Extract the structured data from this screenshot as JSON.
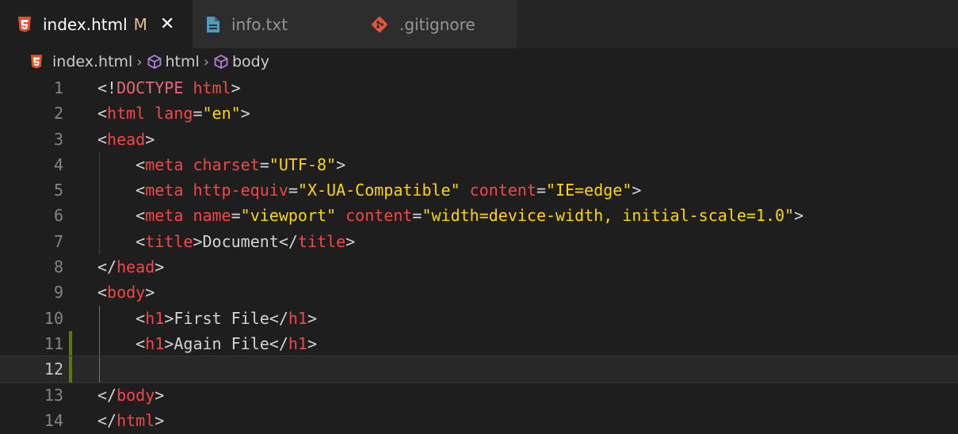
{
  "tabs": [
    {
      "label": "index.html",
      "modified": "M",
      "close": "✕",
      "icon": "html5-icon"
    },
    {
      "label": "info.txt",
      "icon": "text-file-icon"
    },
    {
      "label": ".gitignore",
      "icon": "git-icon"
    }
  ],
  "breadcrumb": {
    "file": "index.html",
    "item1": "html",
    "item2": "body",
    "sep": "›"
  },
  "code": {
    "lines": [
      {
        "num": "1",
        "text": "<!DOCTYPE html>"
      },
      {
        "num": "2",
        "text": "<html lang=\"en\">"
      },
      {
        "num": "3",
        "text": "<head>"
      },
      {
        "num": "4",
        "text": "    <meta charset=\"UTF-8\">"
      },
      {
        "num": "5",
        "text": "    <meta http-equiv=\"X-UA-Compatible\" content=\"IE=edge\">"
      },
      {
        "num": "6",
        "text": "    <meta name=\"viewport\" content=\"width=device-width, initial-scale=1.0\">"
      },
      {
        "num": "7",
        "text": "    <title>Document</title>"
      },
      {
        "num": "8",
        "text": "</head>"
      },
      {
        "num": "9",
        "text": "<body>"
      },
      {
        "num": "10",
        "text": "    <h1>First File</h1>"
      },
      {
        "num": "11",
        "text": "    <h1>Again File</h1>"
      },
      {
        "num": "12",
        "text": ""
      },
      {
        "num": "13",
        "text": "</body>"
      },
      {
        "num": "14",
        "text": "</html>"
      }
    ],
    "current_line": "12"
  },
  "colors": {
    "background": "#1e1e1e",
    "tag": "#f44747",
    "string": "#ffd700",
    "git_added": "#587c0c",
    "modified": "#e2c08d"
  }
}
